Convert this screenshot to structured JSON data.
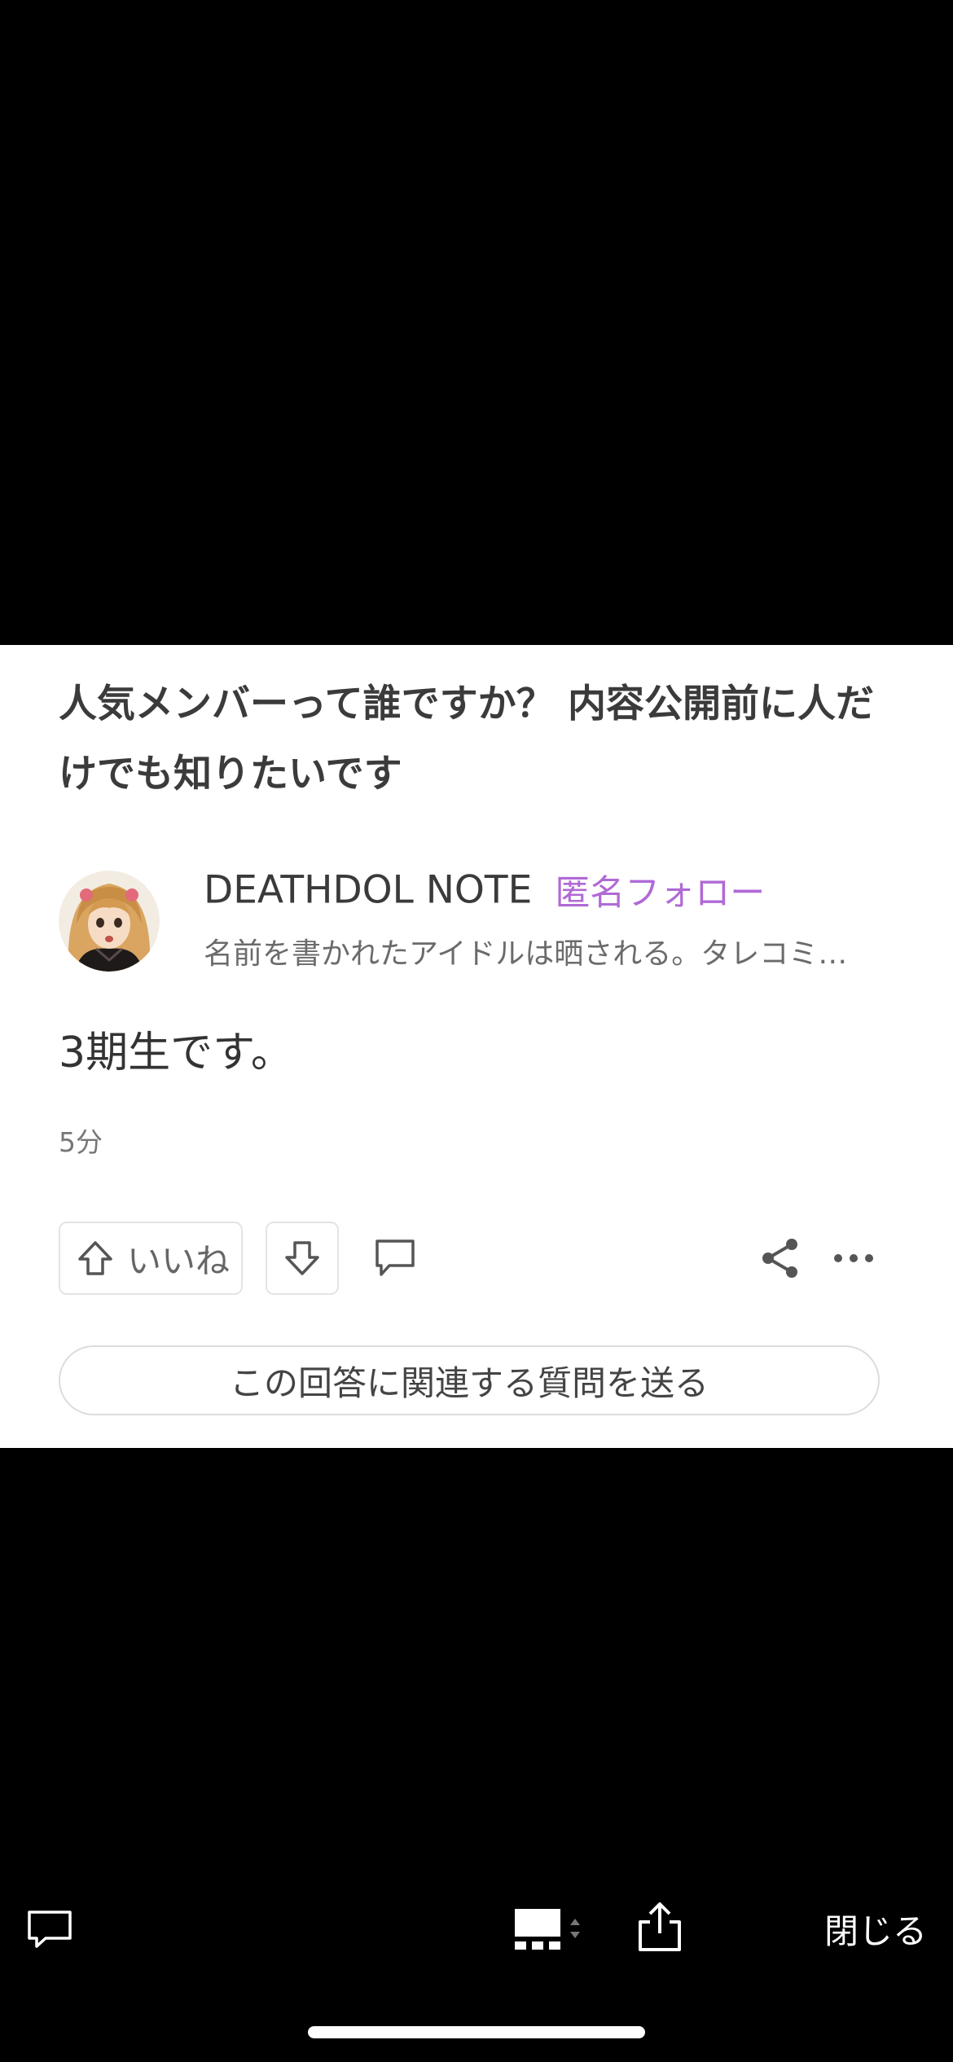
{
  "post": {
    "question_title": "人気メンバーって誰ですか？ 内容公開前に人だけでも知りたいです",
    "author": {
      "name": "DEATHDOL NOTE",
      "follow_label": "匿名フォロー",
      "bio": "名前を書かれたアイドルは晒される。タレコミ…"
    },
    "answer_text": "3期生です。",
    "timestamp": "5分",
    "actions": {
      "upvote_label": "いいね"
    },
    "related_question_label": "この回答に関連する質問を送る"
  },
  "viewer_toolbar": {
    "close_label": "閉じる"
  },
  "colors": {
    "accent_follow": "#b06ad6",
    "background_card": "#ffffff",
    "background_viewer": "#000000"
  },
  "icons": [
    "comment-icon",
    "layout-icon",
    "share-icon",
    "upvote-arrow-icon",
    "downvote-arrow-icon",
    "reply-icon",
    "more-icon"
  ]
}
